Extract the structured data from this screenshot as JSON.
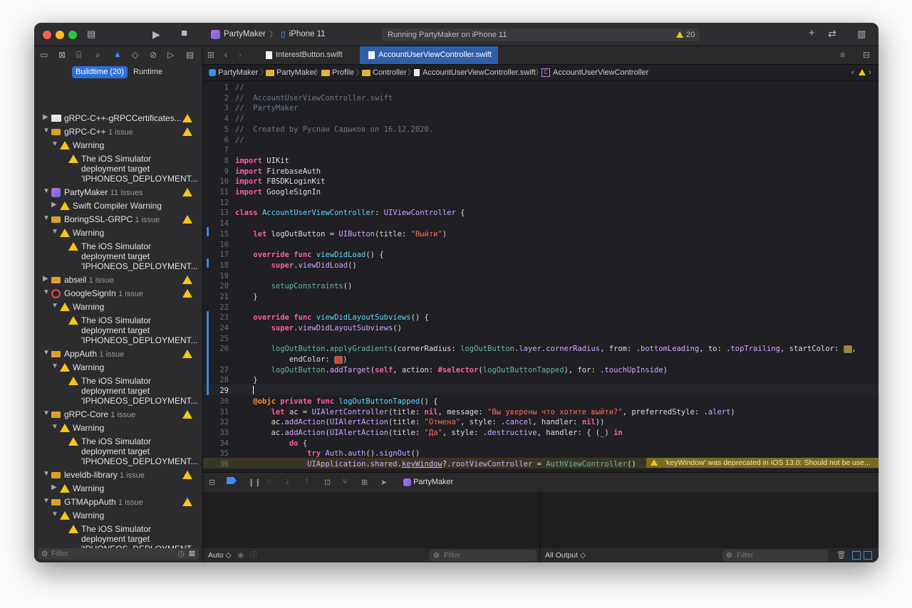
{
  "window": {
    "scheme": "PartyMaker",
    "device": "iPhone 11",
    "status": "Running PartyMaker on iPhone 11",
    "warning_count": "20"
  },
  "navigator": {
    "seg_build": "Buildtime (20)",
    "seg_runtime": "Runtime",
    "filter_placeholder": "Filter",
    "items": [
      {
        "label": "gRPC-C++-gRPCCertificates...",
        "count": ""
      },
      {
        "label": "gRPC-C++",
        "count": "1 issue"
      },
      {
        "label": "Warning"
      },
      {
        "msg1": "The iOS Simulator",
        "msg2": "deployment target",
        "msg3": "'IPHONEOS_DEPLOYMENT..."
      },
      {
        "label": "PartyMaker",
        "count": "11 issues"
      },
      {
        "label": "Swift Compiler Warning"
      },
      {
        "label": "BoringSSL-GRPC",
        "count": "1 issue"
      },
      {
        "label": "Warning"
      },
      {
        "msg1": "The iOS Simulator",
        "msg2": "deployment target",
        "msg3": "'IPHONEOS_DEPLOYMENT..."
      },
      {
        "label": "abseil",
        "count": "1 issue"
      },
      {
        "label": "GoogleSignIn",
        "count": "1 issue"
      },
      {
        "label": "Warning"
      },
      {
        "msg1": "The iOS Simulator",
        "msg2": "deployment target",
        "msg3": "'IPHONEOS_DEPLOYMENT..."
      },
      {
        "label": "AppAuth",
        "count": "1 issue"
      },
      {
        "label": "Warning"
      },
      {
        "msg1": "The iOS Simulator",
        "msg2": "deployment target",
        "msg3": "'IPHONEOS_DEPLOYMENT..."
      },
      {
        "label": "gRPC-Core",
        "count": "1 issue"
      },
      {
        "label": "Warning"
      },
      {
        "msg1": "The iOS Simulator",
        "msg2": "deployment target",
        "msg3": "'IPHONEOS_DEPLOYMENT..."
      },
      {
        "label": "leveldb-library",
        "count": "1 issue"
      },
      {
        "label": "Warning"
      },
      {
        "label": "GTMAppAuth",
        "count": "1 issue"
      },
      {
        "label": "Warning"
      },
      {
        "msg1": "The iOS Simulator",
        "msg2": "deployment target",
        "msg3": "'IPHONEOS_DEPLOYMENT..."
      }
    ]
  },
  "tabs": [
    "InterestButton.swift",
    "AccountUserViewController.swift"
  ],
  "breadcrumb": [
    "PartyMaker",
    "PartyMaker",
    "Profile",
    "Controller",
    "AccountUserViewController.swift",
    "AccountUserViewController"
  ],
  "code": {
    "line_numbers": [
      "1",
      "2",
      "3",
      "4",
      "5",
      "6",
      "7",
      "8",
      "9",
      "10",
      "11",
      "12",
      "13",
      "14",
      "15",
      "16",
      "17",
      "18",
      "19",
      "20",
      "21",
      "22",
      "23",
      "24",
      "25",
      "26",
      "",
      "27",
      "28",
      "29",
      "30",
      "31",
      "32",
      "33",
      "34",
      "35",
      "36"
    ],
    "comment_lines": [
      "//",
      "//  AccountUserViewController.swift",
      "//  PartyMaker",
      "//",
      "//  Created by Руслан Садыков on 16.12.2020.",
      "//"
    ],
    "modules": [
      "UIKit",
      "FirebaseAuth",
      "FBSDKLoginKit",
      "GoogleSignIn"
    ],
    "button_title": "\"Выйти\"",
    "alert_message": "\"Вы уверены что хотите выйти?\"",
    "cancel_title": "\"Отмена\"",
    "confirm_title": "\"Да\"",
    "issue_message": "'keyWindow' was deprecated in iOS 13.0: Should not be use..."
  },
  "debug": {
    "target": "PartyMaker",
    "auto_label": "Auto ◇",
    "output_label": "All Output ◇",
    "filter_placeholder": "Filter"
  }
}
